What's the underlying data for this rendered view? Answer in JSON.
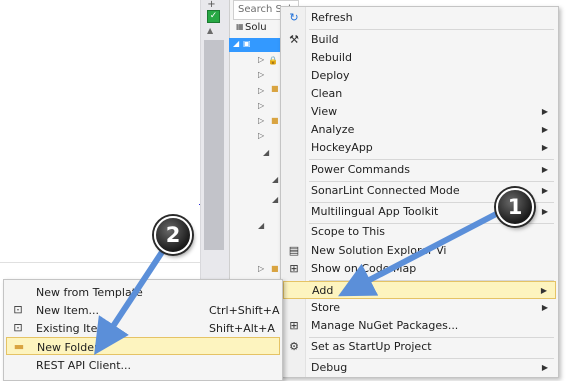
{
  "explorer": {
    "search_placeholder": "Search Solution Explorer (Ctrl+;)",
    "title": "Solu"
  },
  "context_menu": {
    "items": [
      {
        "label": "Refresh",
        "icon": "refresh-icon",
        "submenu": false
      },
      {
        "label": "Build",
        "icon": "build-icon",
        "submenu": false
      },
      {
        "label": "Rebuild",
        "icon": "",
        "submenu": false
      },
      {
        "label": "Deploy",
        "icon": "",
        "submenu": false
      },
      {
        "label": "Clean",
        "icon": "",
        "submenu": false
      },
      {
        "label": "View",
        "icon": "",
        "submenu": true
      },
      {
        "label": "Analyze",
        "icon": "",
        "submenu": true
      },
      {
        "label": "HockeyApp",
        "icon": "",
        "submenu": true
      },
      {
        "label": "Power Commands",
        "icon": "",
        "submenu": true
      },
      {
        "label": "SonarLint Connected Mode",
        "icon": "",
        "submenu": true
      },
      {
        "label": "Multilingual App Toolkit",
        "icon": "",
        "submenu": true
      },
      {
        "label": "Scope to This",
        "icon": "",
        "submenu": false
      },
      {
        "label": "New Solution Explorer Vi",
        "icon": "new-view-icon",
        "submenu": false
      },
      {
        "label": "Show on Code Map",
        "icon": "code-map-icon",
        "submenu": false
      },
      {
        "label": "Add",
        "icon": "",
        "submenu": true
      },
      {
        "label": "Store",
        "icon": "",
        "submenu": true
      },
      {
        "label": "Manage NuGet Packages...",
        "icon": "nuget-icon",
        "submenu": false
      },
      {
        "label": "Set as StartUp Project",
        "icon": "gear-icon",
        "submenu": false
      },
      {
        "label": "Debug",
        "icon": "",
        "submenu": true
      }
    ]
  },
  "add_submenu": {
    "items": [
      {
        "label": "New from Template",
        "shortcut": "",
        "icon": ""
      },
      {
        "label": "New Item...",
        "shortcut": "Ctrl+Shift+A",
        "icon": "new-item-icon"
      },
      {
        "label": "Existing Item...",
        "shortcut": "Shift+Alt+A",
        "icon": "existing-item-icon"
      },
      {
        "label": "New Folder",
        "shortcut": "",
        "icon": "folder-icon"
      },
      {
        "label": "REST API Client...",
        "shortcut": "",
        "icon": ""
      }
    ]
  },
  "callouts": {
    "one": "1",
    "two": "2"
  },
  "colors": {
    "highlight": "#fdf4bf",
    "selection": "#3399ff",
    "arrow": "#5b8fd9"
  }
}
